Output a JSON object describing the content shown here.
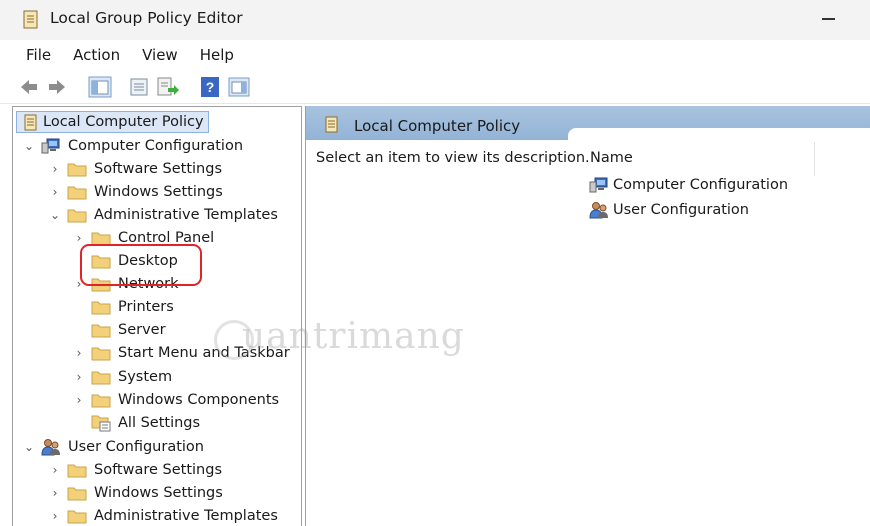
{
  "window": {
    "title": "Local Group Policy Editor",
    "minimize_icon": "minimize-icon"
  },
  "menu": [
    "File",
    "Action",
    "View",
    "Help"
  ],
  "toolbar": {
    "icons": [
      "back-arrow-icon",
      "forward-arrow-icon",
      "show-hide-tree-icon",
      "properties-icon",
      "export-list-icon",
      "help-icon",
      "show-hide-action-pane-icon"
    ]
  },
  "tree": {
    "root": "Local Computer Policy",
    "computer": {
      "label": "Computer Configuration",
      "children": [
        "Software Settings",
        "Windows Settings",
        "Administrative Templates"
      ],
      "admin_children": [
        "Control Panel",
        "Desktop",
        "Network",
        "Printers",
        "Server",
        "Start Menu and Taskbar",
        "System",
        "Windows Components",
        "All Settings"
      ]
    },
    "user": {
      "label": "User Configuration",
      "children": [
        "Software Settings",
        "Windows Settings",
        "Administrative Templates"
      ]
    }
  },
  "details": {
    "header": "Local Computer Policy",
    "description": "Select an item to view its description.",
    "column": "Name",
    "items": [
      "Computer Configuration",
      "User Configuration"
    ]
  },
  "annotation": {
    "highlight_color": "#e0242a",
    "highlighted_item": "Desktop"
  },
  "watermark": {
    "text": "uantrimang"
  },
  "colors": {
    "header_band": "#a9c3df",
    "selection": "#dbe7f6",
    "folder": "#f3d07a"
  }
}
